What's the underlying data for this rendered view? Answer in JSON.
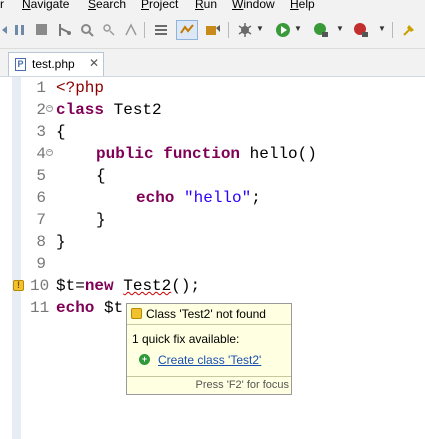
{
  "menubar": {
    "items": [
      "r",
      "Navigate",
      "Search",
      "Project",
      "Run",
      "Window",
      "Help"
    ]
  },
  "toolbar": {
    "icons": [
      "prev-annotation-icon",
      "next-annotation-icon",
      "stop-icon",
      "git-icon",
      "search-icon",
      "refactor-icon",
      "outline-icon",
      "mark-occurrences-icon",
      "php-tool-icon",
      "debug-icon",
      "run-icon",
      "external-tools-icon",
      "coverage-icon",
      "pin-icon"
    ]
  },
  "editor_tab": {
    "label": "test.php",
    "close": "✕"
  },
  "editor": {
    "lines": [
      {
        "num": "1",
        "fold": false
      },
      {
        "num": "2",
        "fold": true
      },
      {
        "num": "3",
        "fold": false
      },
      {
        "num": "4",
        "fold": true
      },
      {
        "num": "5",
        "fold": false
      },
      {
        "num": "6",
        "fold": false
      },
      {
        "num": "7",
        "fold": false
      },
      {
        "num": "8",
        "fold": false
      },
      {
        "num": "9",
        "fold": false
      },
      {
        "num": "10",
        "fold": false
      },
      {
        "num": "11",
        "fold": false
      }
    ],
    "code": {
      "l1": "<?php",
      "l2_kw": "class",
      "l2_rest": " Test2",
      "l3": "{",
      "l4_kw1": "public",
      "l4_kw2": "function",
      "l4_rest": " hello()",
      "l5": "{",
      "l6_kw": "echo",
      "l6_str": "\"hello\"",
      "l6_end": ";",
      "l7": "}",
      "l8": "}",
      "l10_pre": "$t=",
      "l10_kw": "new",
      "l10_cls": "Test2",
      "l10_end": "();",
      "l11_kw": "echo",
      "l11_rest": " $t"
    }
  },
  "quickfix": {
    "title": "Class 'Test2' not found",
    "count": "1 quick fix available:",
    "fix": "Create class 'Test2'",
    "footer": "Press 'F2' for focus"
  },
  "colors": {
    "keyword": "#7f0055",
    "string": "#2a00ff",
    "popup_bg": "#ffffe1",
    "link": "#1a4fb3"
  }
}
